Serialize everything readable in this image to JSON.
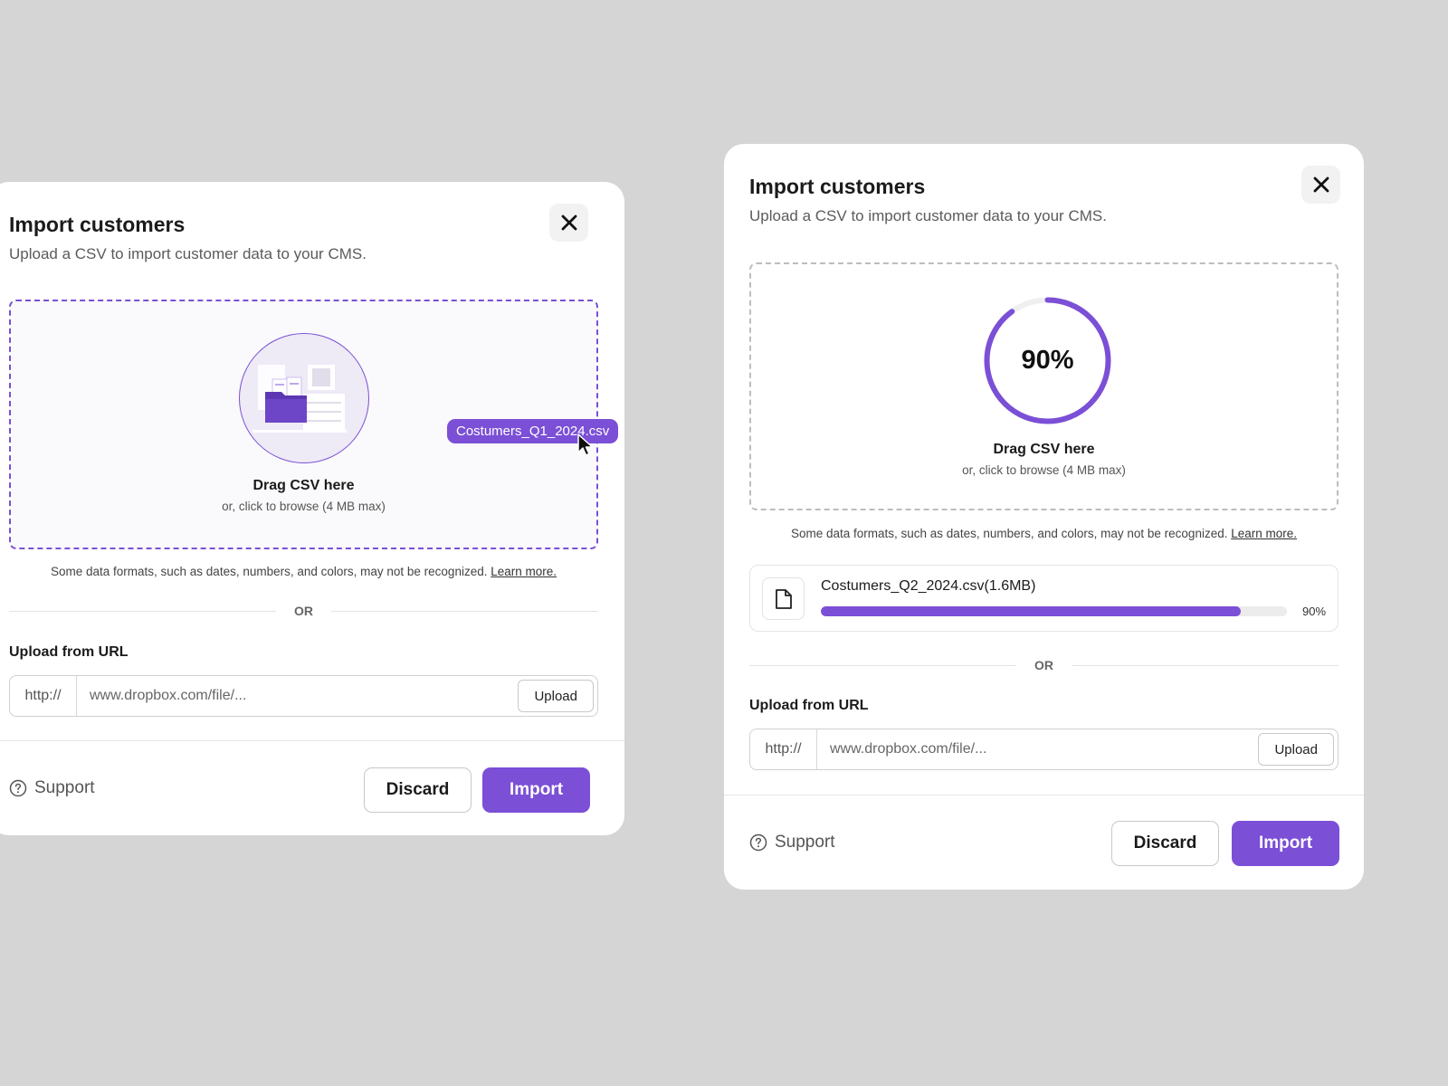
{
  "colors": {
    "accent": "#7b4fd6",
    "background": "#d5d5d5",
    "card": "#ffffff"
  },
  "dialogs": [
    {
      "title": "Import customers",
      "subtitle": "Upload a CSV to import customer data to your CMS.",
      "close_icon": "close-icon",
      "dropzone": {
        "title": "Drag CSV here",
        "subtitle": "or, click to browse (4 MB max)",
        "illustration_icon": "folder-documents-illustration",
        "dragged_file": "Costumers_Q1_2024.csv"
      },
      "note": "Some data formats, such as dates, numbers, and colors, may not be recognized.",
      "note_link": "Learn more.",
      "or_text": "OR",
      "url_section": {
        "label": "Upload from URL",
        "prefix": "http://",
        "placeholder": "www.dropbox.com/file/...",
        "upload_label": "Upload"
      },
      "footer": {
        "support_label": "Support",
        "support_icon": "help-circle-icon",
        "discard_label": "Discard",
        "import_label": "Import"
      }
    },
    {
      "title": "Import customers",
      "subtitle": "Upload a CSV to import customer data to your CMS.",
      "close_icon": "close-icon",
      "dropzone": {
        "title": "Drag CSV here",
        "subtitle": "or, click to browse (4 MB max)",
        "progress_text": "90%",
        "progress": 0.9
      },
      "note": "Some data formats, such as dates, numbers, and colors, may not be recognized.",
      "note_link": "Learn more.",
      "file": {
        "name": "Costumers_Q2_2024.csv(1.6MB)",
        "icon": "file-icon",
        "progress": 0.9,
        "progress_text": "90%"
      },
      "or_text": "OR",
      "url_section": {
        "label": "Upload from URL",
        "prefix": "http://",
        "placeholder": "www.dropbox.com/file/...",
        "upload_label": "Upload"
      },
      "footer": {
        "support_label": "Support",
        "support_icon": "help-circle-icon",
        "discard_label": "Discard",
        "import_label": "Import"
      }
    }
  ]
}
